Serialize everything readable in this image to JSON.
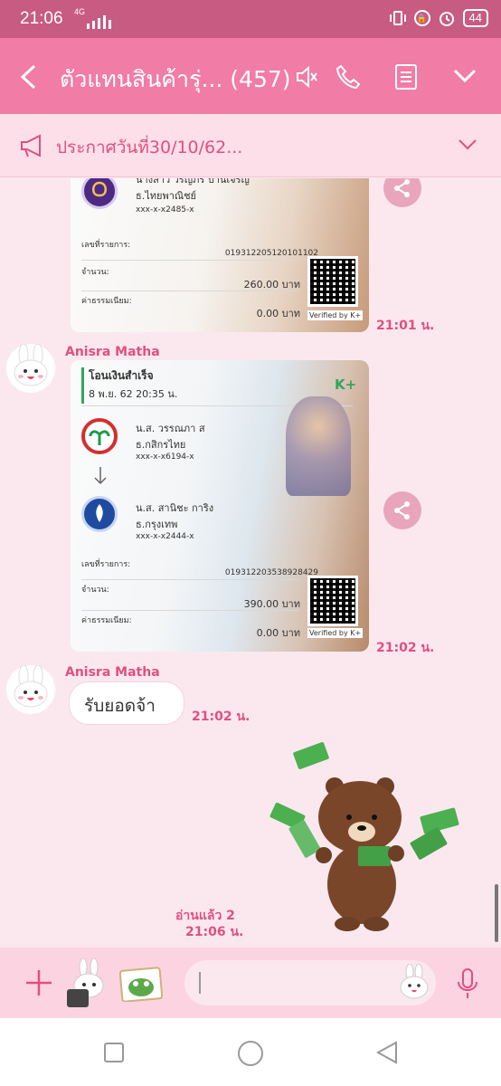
{
  "status_bar": {
    "time": "21:06",
    "network": "4G",
    "battery": "44"
  },
  "header": {
    "title": "ตัวแทนสินค้ารุ่... (457)"
  },
  "announcement": {
    "text": "ประกาศวันที่30/10/62..."
  },
  "messages": {
    "slip1": {
      "recipient_name": "นางสาว วรัญภร ปานเจริญ",
      "recipient_bank": "ธ.ไทยพาณิชย์",
      "recipient_account": "xxx-x-x2485-x",
      "ref_label": "เลขที่รายการ:",
      "ref_value": "019312205120101102",
      "amount_label": "จำนวน:",
      "amount_value": "260.00 บาท",
      "fee_label": "ค่าธรรมเนียม:",
      "fee_value": "0.00 บาท",
      "verified": "Verified by K+",
      "timestamp": "21:01 น."
    },
    "slip2": {
      "sender": "Anisra Matha",
      "title": "โอนเงินสำเร็จ",
      "date": "8 พ.ย. 62  20:35 น.",
      "brand": "K+",
      "from_name": "น.ส. วรรณภา ส",
      "from_bank": "ธ.กสิกรไทย",
      "from_account": "xxx-x-x6194-x",
      "to_name": "น.ส. สานิชะ การิง",
      "to_bank": "ธ.กรุงเทพ",
      "to_account": "xxx-x-x2444-x",
      "ref_label": "เลขที่รายการ:",
      "ref_value": "019312203538928429",
      "amount_label": "จำนวน:",
      "amount_value": "390.00 บาท",
      "fee_label": "ค่าธรรมเนียม:",
      "fee_value": "0.00 บาท",
      "verified": "Verified by K+",
      "timestamp": "21:02 น."
    },
    "text_msg": {
      "sender": "Anisra Matha",
      "text": "รับยอดจ้า",
      "timestamp": "21:02 น."
    },
    "sticker": {
      "read_status": "อ่านแล้ว 2",
      "timestamp": "21:06 น."
    }
  },
  "colors": {
    "header": "#f17ca6",
    "accent": "#e0507e",
    "background": "#fbe8ef"
  }
}
